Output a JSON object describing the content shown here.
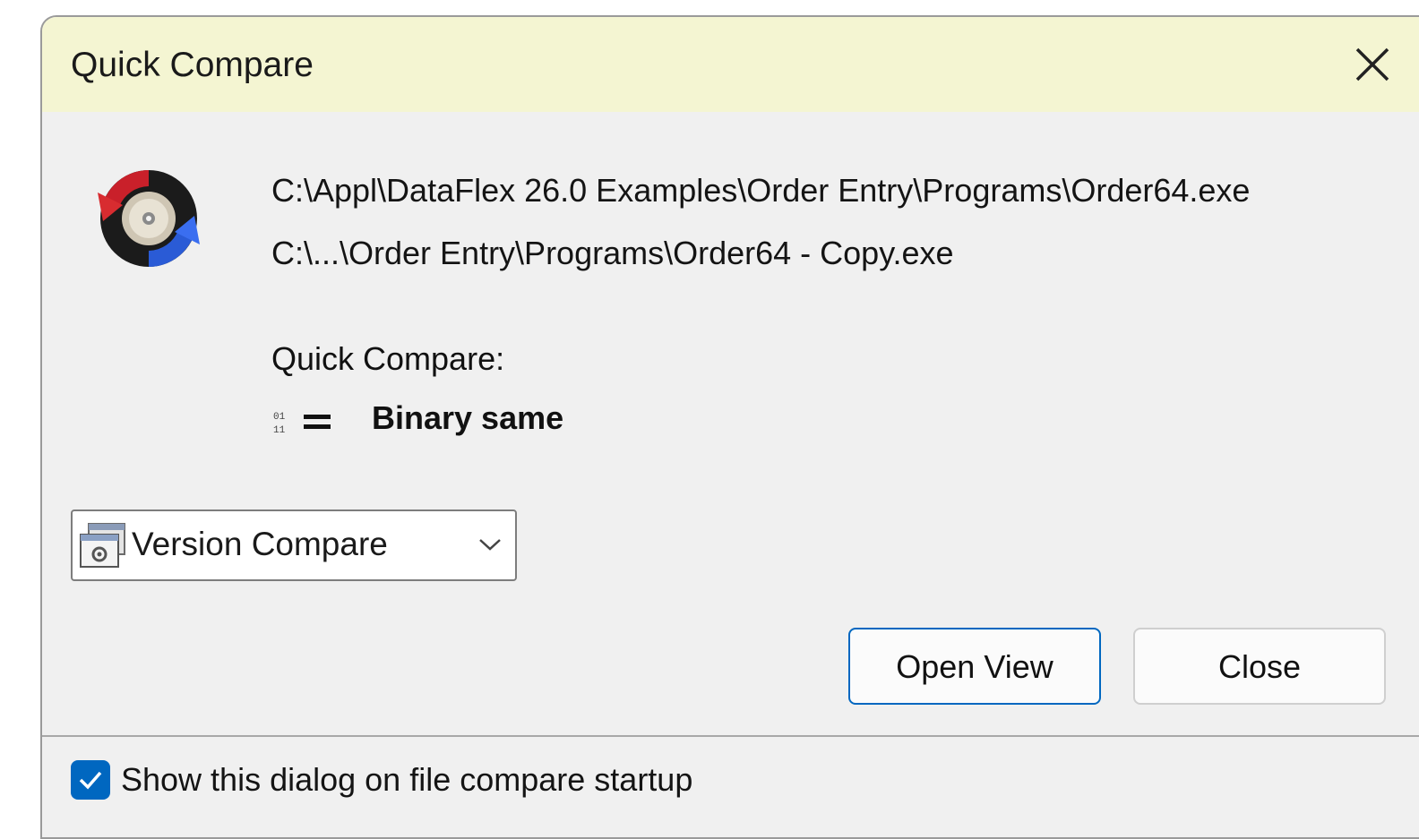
{
  "window": {
    "title": "Quick Compare",
    "close_icon": "close-icon"
  },
  "files": {
    "left_path": "C:\\Appl\\DataFlex 26.0 Examples\\Order Entry\\Programs\\Order64.exe",
    "right_path": "C:\\...\\Order Entry\\Programs\\Order64 - Copy.exe"
  },
  "compare": {
    "label": "Quick Compare:",
    "result_icon": "binary-equal-icon",
    "result_text": "Binary same"
  },
  "session_type": {
    "selected": "Version Compare",
    "icon": "version-compare-icon"
  },
  "buttons": {
    "open_view": "Open View",
    "close": "Close"
  },
  "footer": {
    "show_on_startup_label": "Show this dialog on file compare startup",
    "show_on_startup_checked": true
  },
  "colors": {
    "title_bar": "#f4f5d2",
    "dialog_bg": "#f0f0f0",
    "accent": "#0067c0"
  }
}
